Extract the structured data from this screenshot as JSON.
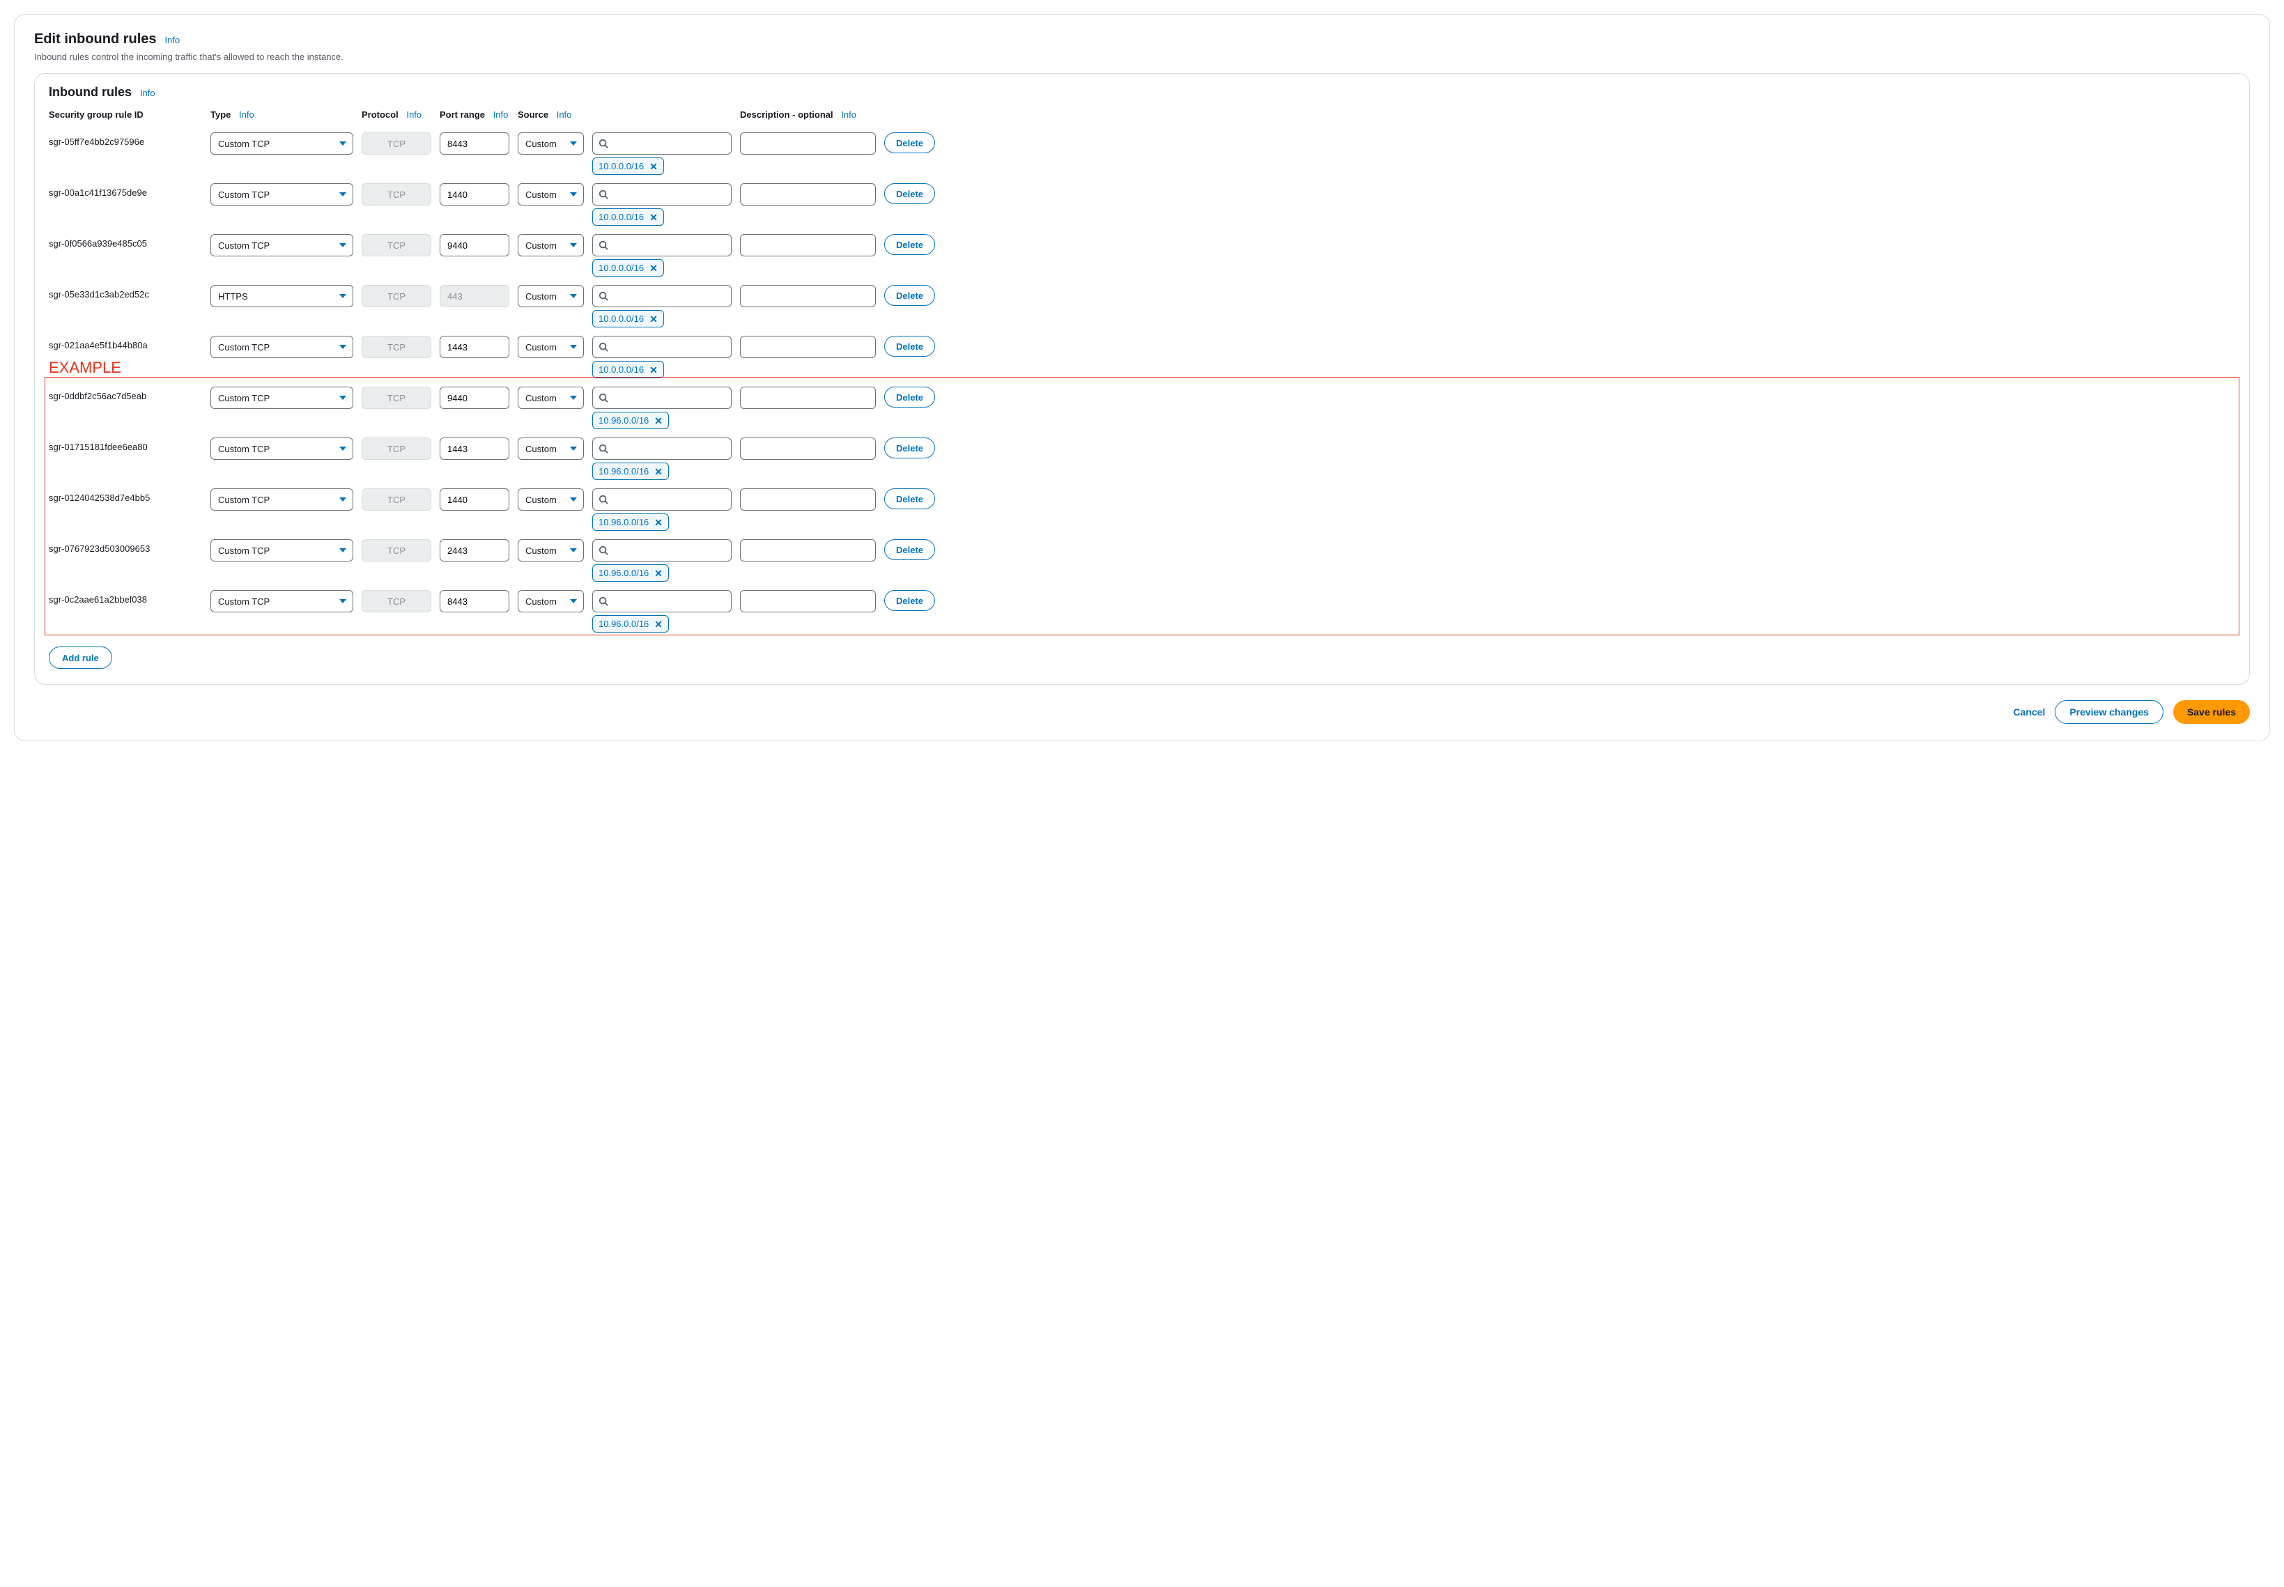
{
  "header": {
    "title": "Edit inbound rules",
    "info_label": "Info",
    "subtitle": "Inbound rules control the incoming traffic that's allowed to reach the instance."
  },
  "panel": {
    "title": "Inbound rules",
    "info_label": "Info"
  },
  "columns": {
    "rule_id": "Security group rule ID",
    "type": "Type",
    "protocol": "Protocol",
    "port_range": "Port range",
    "source": "Source",
    "description": "Description - optional",
    "info_label": "Info"
  },
  "example_label": "EXAMPLE",
  "rules": [
    {
      "id": "sgr-05ff7e4bb2c97596e",
      "type": "Custom TCP",
      "protocol": "TCP",
      "port": "8443",
      "port_disabled": false,
      "source": "Custom",
      "cidr": "10.0.0.0/16",
      "description": ""
    },
    {
      "id": "sgr-00a1c41f13675de9e",
      "type": "Custom TCP",
      "protocol": "TCP",
      "port": "1440",
      "port_disabled": false,
      "source": "Custom",
      "cidr": "10.0.0.0/16",
      "description": ""
    },
    {
      "id": "sgr-0f0566a939e485c05",
      "type": "Custom TCP",
      "protocol": "TCP",
      "port": "9440",
      "port_disabled": false,
      "source": "Custom",
      "cidr": "10.0.0.0/16",
      "description": ""
    },
    {
      "id": "sgr-05e33d1c3ab2ed52c",
      "type": "HTTPS",
      "protocol": "TCP",
      "port": "443",
      "port_disabled": true,
      "source": "Custom",
      "cidr": "10.0.0.0/16",
      "description": ""
    },
    {
      "id": "sgr-021aa4e5f1b44b80a",
      "type": "Custom TCP",
      "protocol": "TCP",
      "port": "1443",
      "port_disabled": false,
      "source": "Custom",
      "cidr": "10.0.0.0/16",
      "description": ""
    },
    {
      "id": "sgr-0ddbf2c56ac7d5eab",
      "type": "Custom TCP",
      "protocol": "TCP",
      "port": "9440",
      "port_disabled": false,
      "source": "Custom",
      "cidr": "10.96.0.0/16",
      "description": ""
    },
    {
      "id": "sgr-01715181fdee6ea80",
      "type": "Custom TCP",
      "protocol": "TCP",
      "port": "1443",
      "port_disabled": false,
      "source": "Custom",
      "cidr": "10.96.0.0/16",
      "description": ""
    },
    {
      "id": "sgr-0124042538d7e4bb5",
      "type": "Custom TCP",
      "protocol": "TCP",
      "port": "1440",
      "port_disabled": false,
      "source": "Custom",
      "cidr": "10.96.0.0/16",
      "description": ""
    },
    {
      "id": "sgr-0767923d503009653",
      "type": "Custom TCP",
      "protocol": "TCP",
      "port": "2443",
      "port_disabled": false,
      "source": "Custom",
      "cidr": "10.96.0.0/16",
      "description": ""
    },
    {
      "id": "sgr-0c2aae61a2bbef038",
      "type": "Custom TCP",
      "protocol": "TCP",
      "port": "8443",
      "port_disabled": false,
      "source": "Custom",
      "cidr": "10.96.0.0/16",
      "description": ""
    }
  ],
  "buttons": {
    "delete": "Delete",
    "add_rule": "Add rule",
    "cancel": "Cancel",
    "preview": "Preview changes",
    "save": "Save rules"
  }
}
